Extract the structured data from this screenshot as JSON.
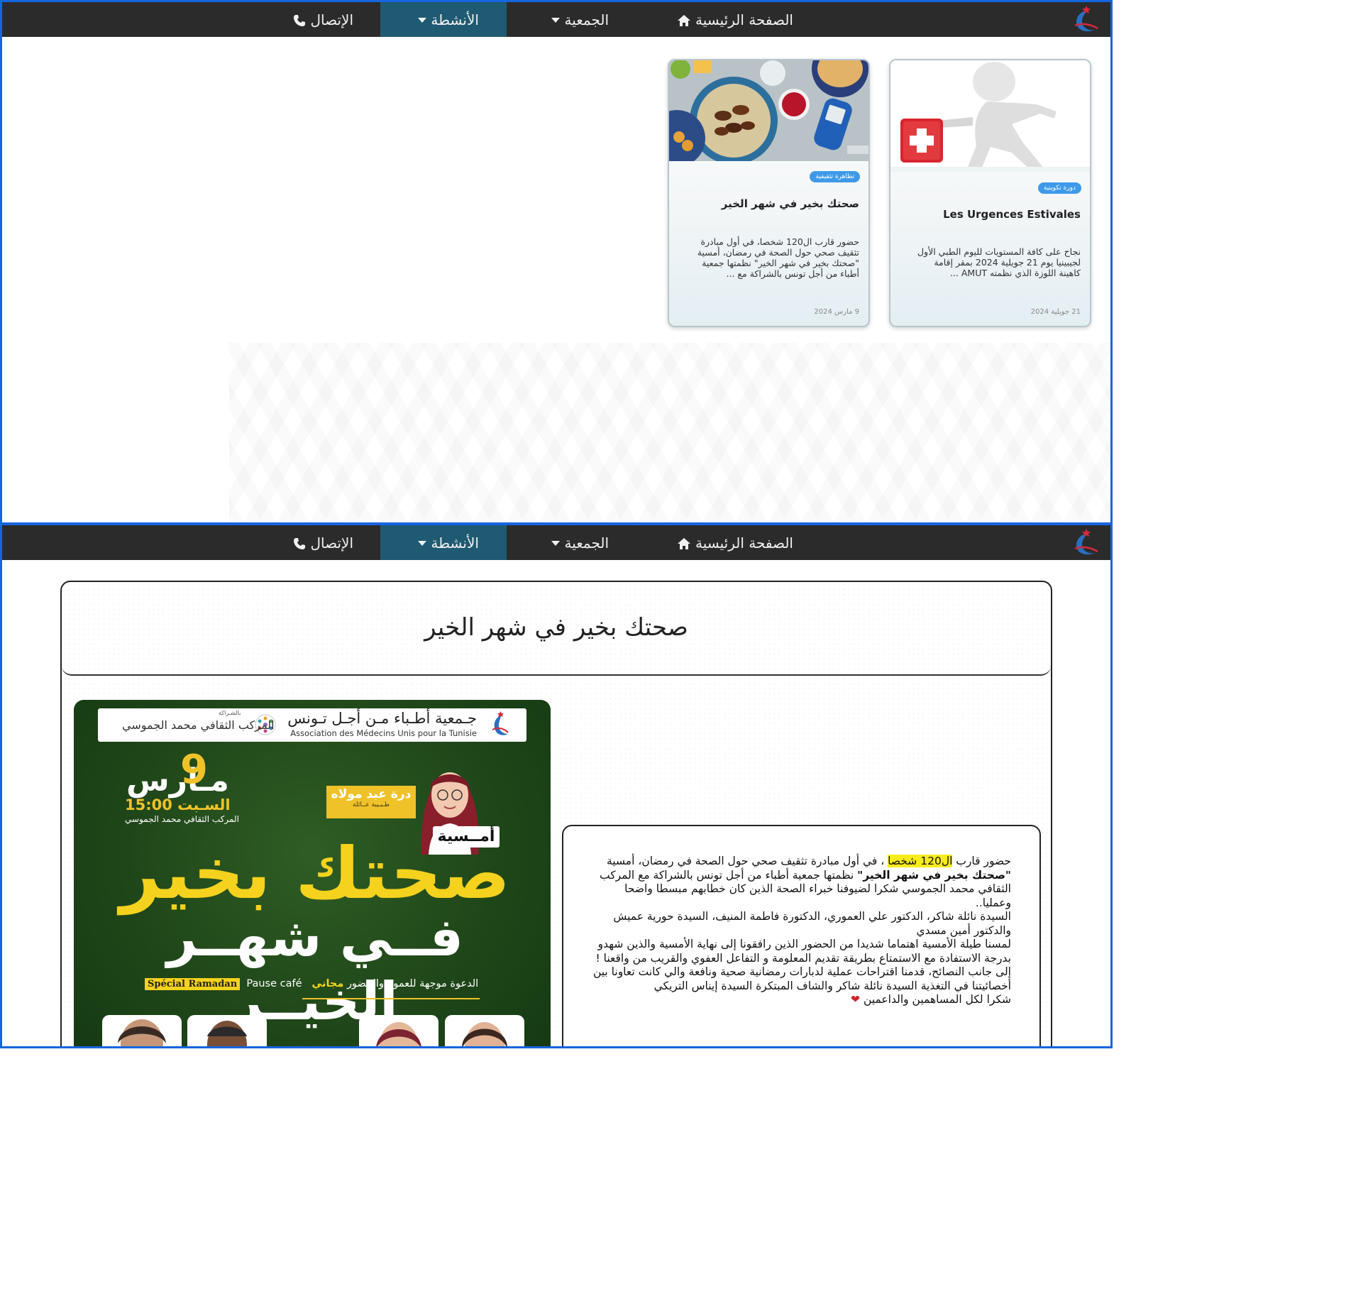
{
  "nav": {
    "home": "الصفحة الرئيسية",
    "association": "الجمعية",
    "activities": "الأنشطة",
    "contact": "الإتصال",
    "icons": [
      "home-icon",
      "caret-down-icon",
      "phone-icon"
    ],
    "active_color": "#1f5a73",
    "bar_color": "#2b2b2b"
  },
  "cards": [
    {
      "tag": "دورة تكوينية",
      "title": "Les Urgences Estivales",
      "description": "نجاح على كافة المستويات لليوم الطبي الأول لجيبينيا يوم 21 جويلية 2024 بمقر إقامة كاهينة اللوزة الذي نظمته AMUT ...",
      "date": "21 جويلية 2024"
    },
    {
      "tag": "تظاهرة تثقيفية",
      "title": "صحتك بخير في شهر الخير",
      "description": "حضور قارب ال120 شخصا، في أول مبادرة تثقيف صحي حول الصحة في رمضان، أمسية \"صحتك بخير في شهر الخير\" نظمتها جمعية أطباء من أجل تونس بالشراكة مع ...",
      "date": "9 مارس 2024"
    }
  ],
  "article": {
    "title": "صحتك بخير في شهر الخير",
    "poster": {
      "association_ar": "جـمعية أطـباء مـن أجـل تـونس",
      "association_fr": "Association des Médecins Unis pour la Tunisie",
      "partner_label": "بالشـراكة",
      "partner_name": "المركب الثقافي محمد الجموسي",
      "day": "9",
      "month": "مـارس",
      "time": "السـبت 15:00",
      "place": "المركب الثقافي محمد الجموسي",
      "speaker_name": "درة عبد مولاه",
      "speaker_role": "طـبـيبة عــائلة",
      "badge": "أمــسية",
      "headline1": "صحتك بخير",
      "headline2": "فــي شهــر الخيــر",
      "invite_pre": "الدعوة موجهة للعموم والحضور",
      "invite_free": "مجاني",
      "invite_special": "Spécial Ramadan",
      "invite_pause": "Pause café"
    },
    "text": {
      "p1_pre": "حضور قارب ",
      "p1_highlight": "ال120 شخصا",
      "p1_post": " ، في أول مبادرة تثقيف صحي حول الصحة في رمضان، أمسية ",
      "p1_bold": "\"صحتك بخير في شهر الخير\"",
      "p1_end": " نظمتها جمعية أطباء من أجل تونس بالشراكة مع المركب الثقافي محمد الجموسي شكرا لضيوفنا خبراء الصحة الذين كان خطابهم مبسطا واضحا وعمليا..",
      "p2": "السيدة نائلة شاكر، الدكتور علي العموري، الدكتورة فاطمة المنيف، السيدة حورية عميش والدكتور أمين مسدي",
      "p3": "لمسنا طيلة الأمسية اهتماما شديدا من الحضور الذين رافقونا إلى نهاية الأمسية والذين شهدو بدرجة الاستفادة مع الاستمتاع بطريقة تقديم المعلومة و التفاعل العفوي والقريب من واقعنا !",
      "p4": "إلى جانب النصائح، قدمنا اقتراحات عملية لدبارات رمضانية صحية ونافعة والي كانت تعاونا بين أخصائيتنا في التغذية السيدة نائلة شاكر والشاف المبتكرة السيدة إيناس التريكي",
      "p5": "شكرا لكل المساهمين والداعمين",
      "heart": "❤"
    }
  },
  "colors": {
    "frame_border": "#1565e0",
    "tag": "#3e9ae8",
    "highlight": "#f7ec1b",
    "poster_yellow": "#f5d21d",
    "poster_green": "#1f4619"
  }
}
